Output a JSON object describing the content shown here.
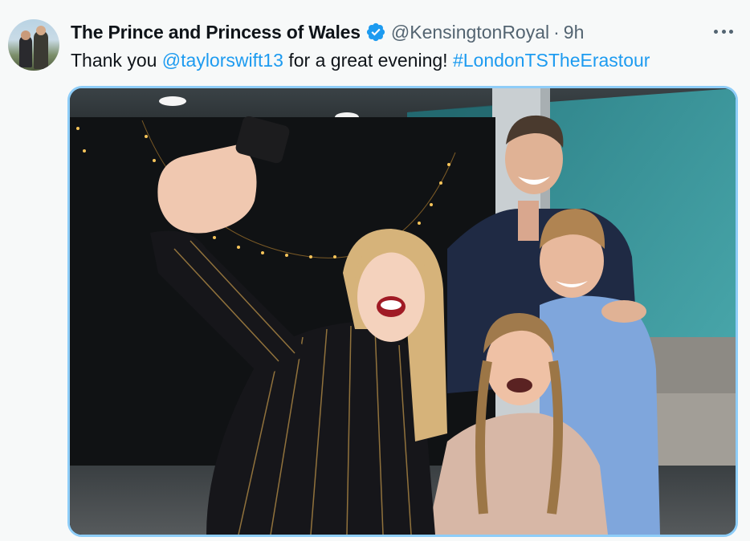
{
  "author": {
    "display_name": "The Prince and Princess of Wales",
    "handle": "@KensingtonRoyal",
    "separator": "·",
    "time": "9h",
    "avatar_icon": "avatar-photo",
    "verified_icon": "verified-badge-icon"
  },
  "tweet": {
    "text_prefix": "Thank you ",
    "mention": "@taylorswift13",
    "text_middle": " for a great evening! ",
    "hashtag": "#LondonTSTheErastour"
  },
  "colors": {
    "link": "#1d9bf0",
    "verified": "#1d9bf0",
    "media_border": "#8ecdf8",
    "secondary_text": "#536471"
  },
  "more_icon": "more-horizontal-icon"
}
